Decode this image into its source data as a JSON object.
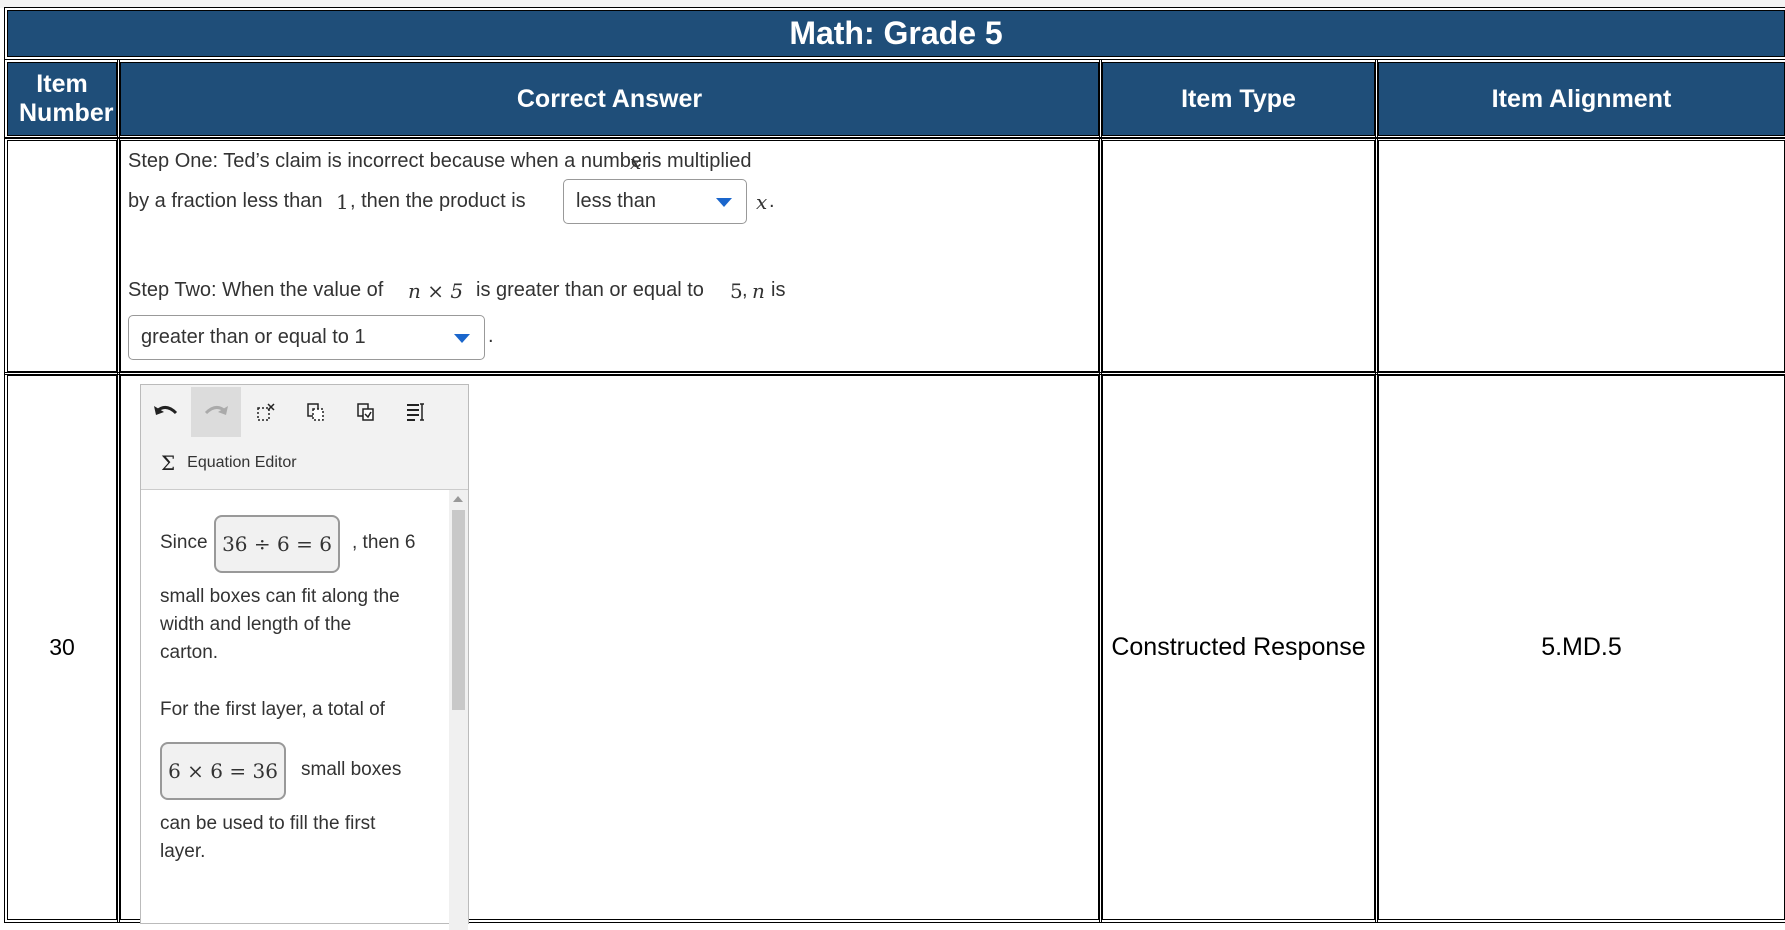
{
  "table": {
    "title": "Math: Grade 5",
    "headers": {
      "item_number": "Item Number",
      "correct_answer": "Correct Answer",
      "item_type": "Item Type",
      "item_alignment": "Item Alignment"
    },
    "row1": {
      "item_number": "",
      "step_one": {
        "line1_a": "Step One: Ted’s claim is incorrect because when a number",
        "line1_var": "x",
        "line1_b": "is multiplied",
        "line2_a": "by a fraction less than",
        "line2_num": "1",
        "line2_b": ", then the product is",
        "dropdown_value": "less than",
        "line2_var": "x",
        "line2_end": "."
      },
      "step_two": {
        "line1_a": "Step Two: When the value of",
        "line1_expr": "n × 5",
        "line1_b": "is greater than or equal to",
        "line1_num": "5",
        "line1_c": ",",
        "line1_var": "n",
        "line1_d": "is",
        "dropdown_value": "greater than or equal to 1",
        "line2_end": "."
      },
      "item_type": "",
      "item_alignment": ""
    },
    "row2": {
      "item_number": "30",
      "item_type": "Constructed Response",
      "item_alignment": "5.MD.5",
      "editor": {
        "toolbar_icons": [
          "undo-icon",
          "redo-icon",
          "cut-icon",
          "copy-icon",
          "paste-icon",
          "special-character-icon"
        ],
        "equation_editor_symbol": "Σ",
        "equation_editor_label": "Equation Editor",
        "content": {
          "p1_since": "Since",
          "p1_box": "36 ÷ 6 = 6",
          "p1_after": ", then 6",
          "p1_line2": "small boxes can fit along the",
          "p1_line3": "width and length of the",
          "p1_line4": "carton.",
          "p2_line1": "For the first layer, a total of",
          "p2_box": "6 × 6 = 36",
          "p2_after": "small boxes",
          "p2_line3": "can be used to fill the first",
          "p2_line4": "layer."
        }
      }
    }
  }
}
